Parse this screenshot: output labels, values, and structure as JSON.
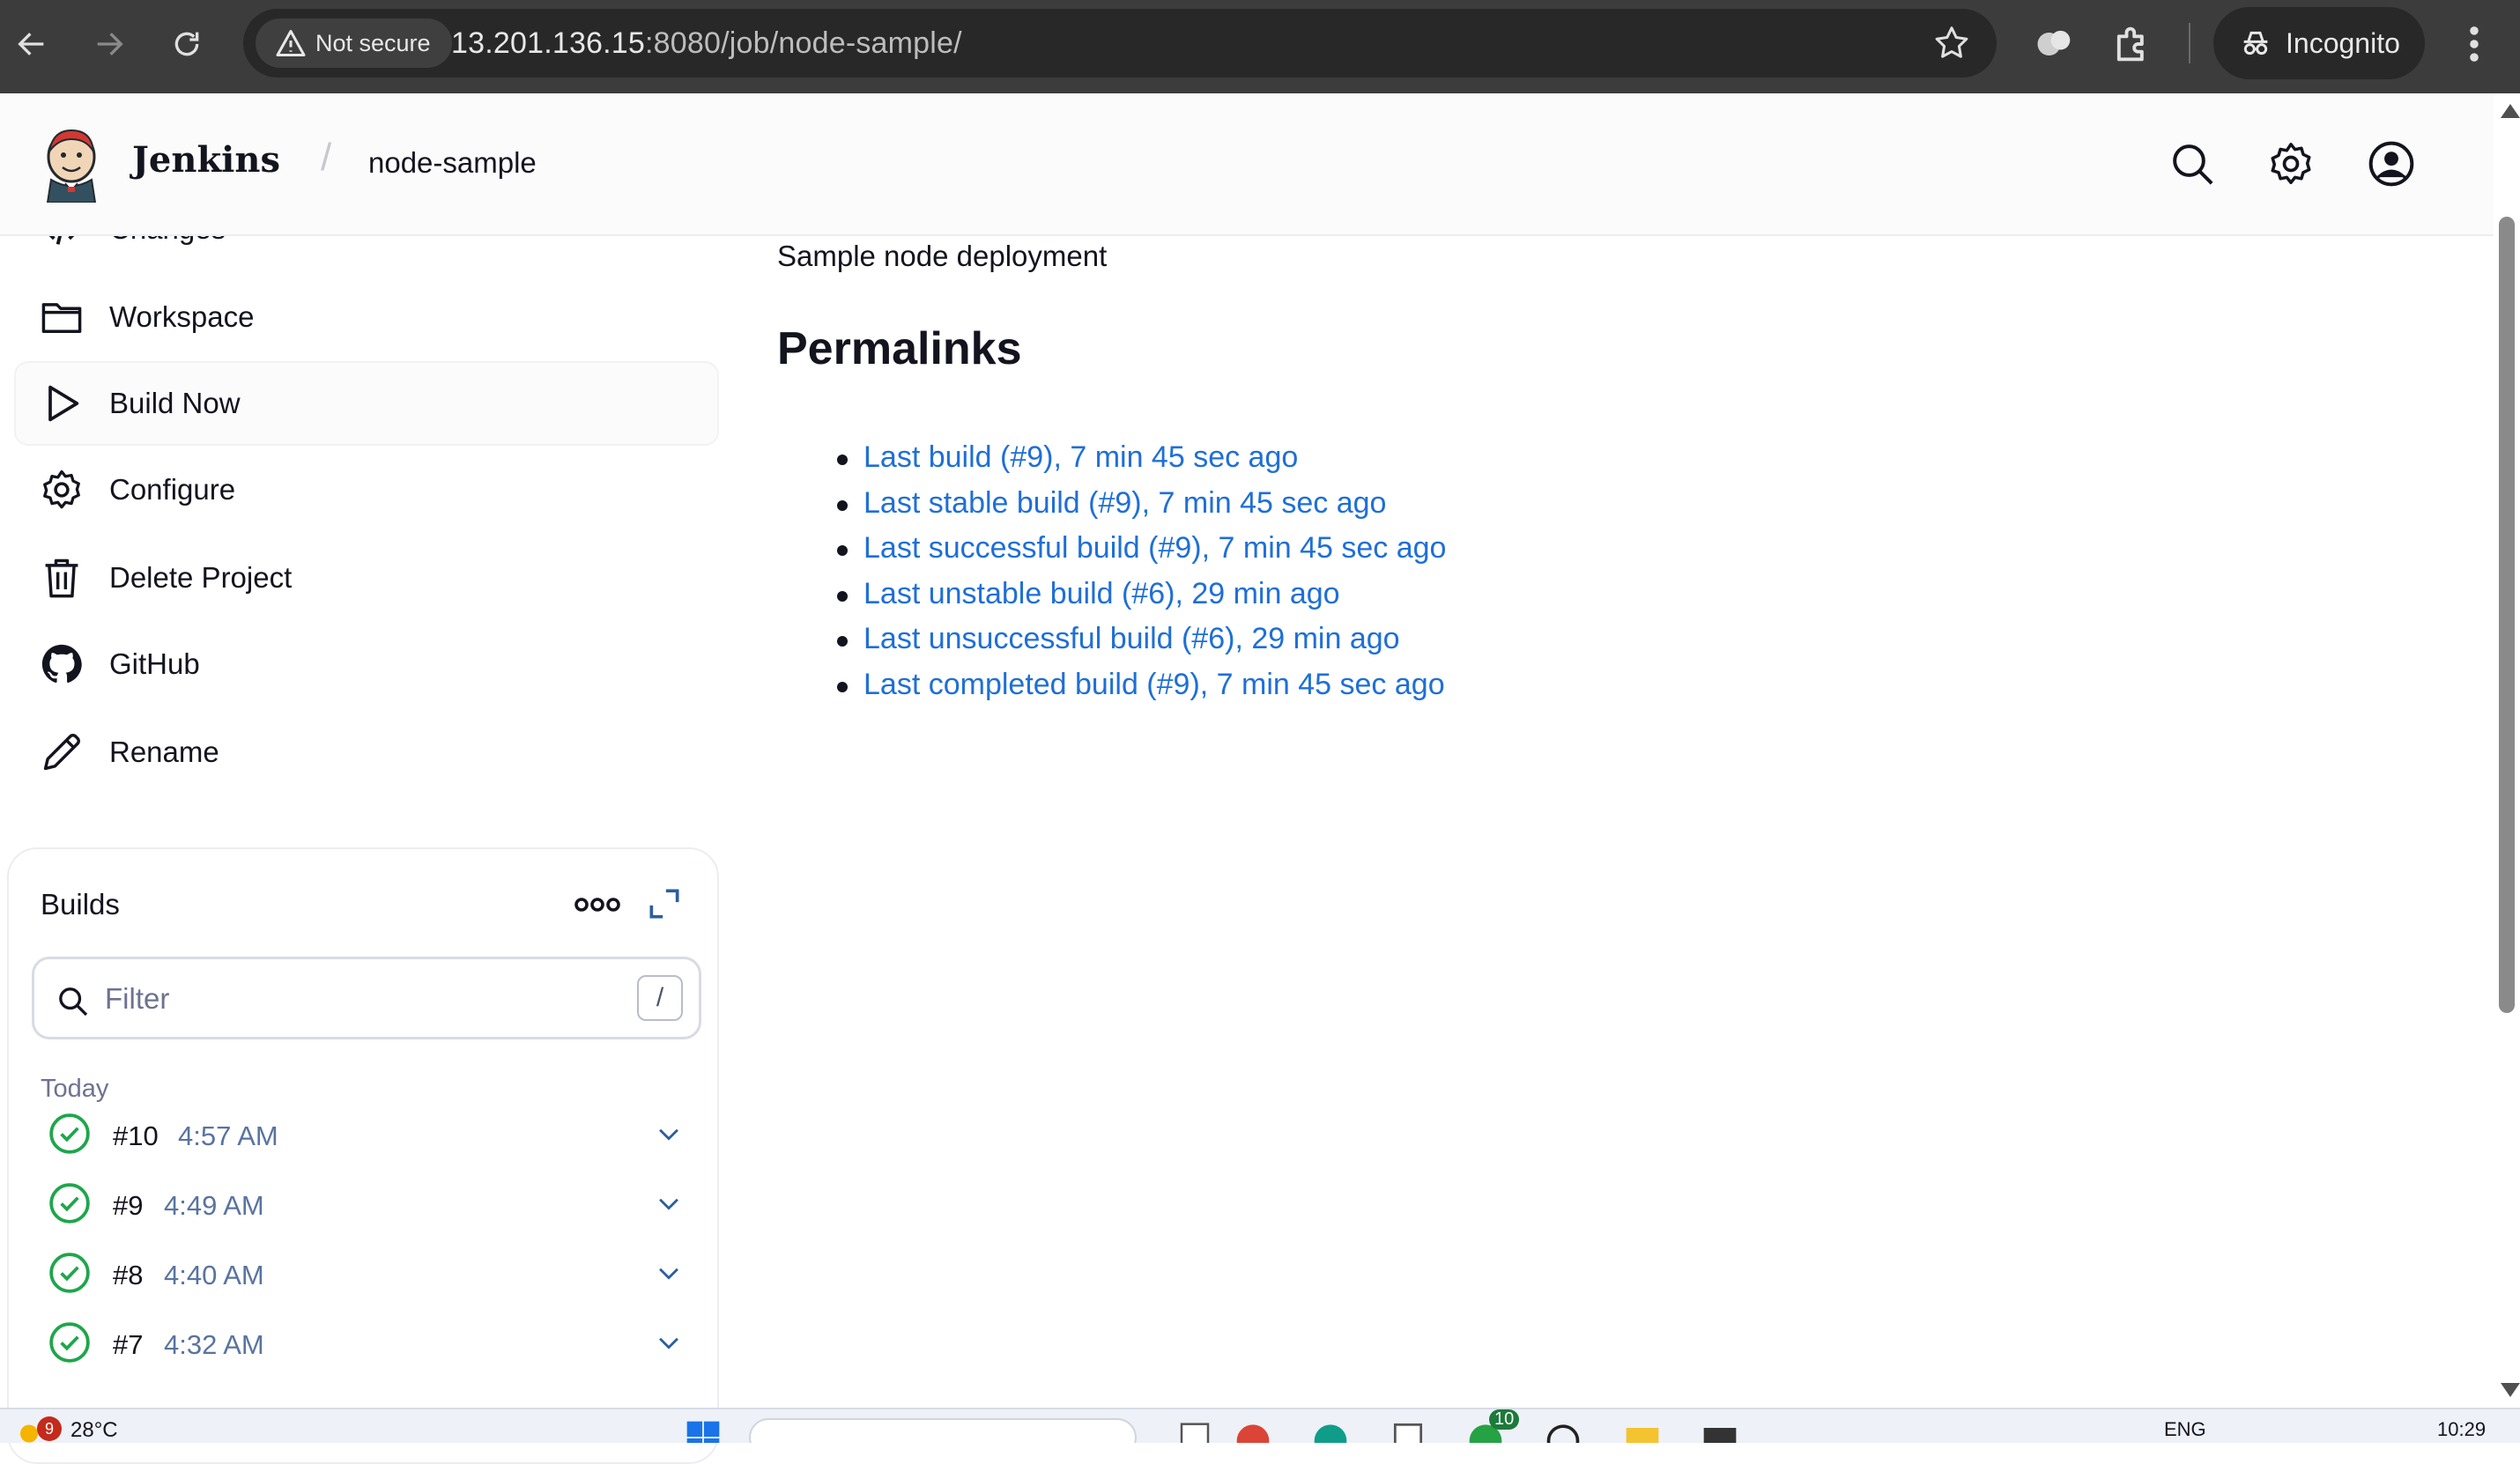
{
  "browser": {
    "security_label": "Not secure",
    "url_host": "13.201.136.15",
    "url_rest": ":8080/job/node-sample/",
    "incognito_label": "Incognito"
  },
  "header": {
    "brand": "Jenkins",
    "breadcrumb_separator": "/",
    "breadcrumb": "node-sample"
  },
  "sidebar": {
    "partial_item": "Changes",
    "items": [
      {
        "label": "Workspace",
        "icon": "folder-icon"
      },
      {
        "label": "Build Now",
        "icon": "play-icon"
      },
      {
        "label": "Configure",
        "icon": "gear-icon"
      },
      {
        "label": "Delete Project",
        "icon": "trash-icon"
      },
      {
        "label": "GitHub",
        "icon": "github-icon"
      },
      {
        "label": "Rename",
        "icon": "pencil-icon"
      }
    ]
  },
  "builds": {
    "title": "Builds",
    "filter_placeholder": "Filter",
    "filter_shortcut": "/",
    "group_label": "Today",
    "rows": [
      {
        "number": "#10",
        "time": "4:57 AM",
        "status": "success"
      },
      {
        "number": "#9",
        "time": "4:49 AM",
        "status": "success"
      },
      {
        "number": "#8",
        "time": "4:40 AM",
        "status": "success"
      },
      {
        "number": "#7",
        "time": "4:32 AM",
        "status": "success"
      }
    ]
  },
  "main": {
    "description": "Sample node deployment",
    "permalinks_title": "Permalinks",
    "permalinks": [
      "Last build (#9), 7 min 45 sec ago",
      "Last stable build (#9), 7 min 45 sec ago",
      "Last successful build (#9), 7 min 45 sec ago",
      "Last unstable build (#6), 29 min ago",
      "Last unsuccessful build (#6), 29 min ago",
      "Last completed build (#9), 7 min 45 sec ago"
    ]
  },
  "taskbar": {
    "weather_badge": "9",
    "temperature": "28°C",
    "language": "ENG",
    "clock": "10:29",
    "app_badge": "10"
  },
  "colors": {
    "link": "#1f6fd6",
    "success": "#1ea64b",
    "build_time": "#5874a0"
  }
}
